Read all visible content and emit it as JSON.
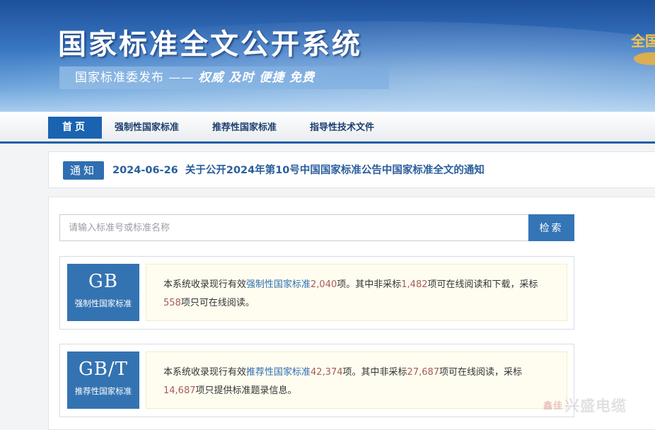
{
  "header": {
    "title": "国家标准全文公开系统",
    "subtitle_prefix": "国家标准委发布 ——",
    "subtitle_slogan": "权威 及时 便捷 免费",
    "right_partial": "全国"
  },
  "nav": {
    "items": [
      {
        "label": "首页",
        "active": true
      },
      {
        "label": "强制性国家标准"
      },
      {
        "label": "推荐性国家标准"
      },
      {
        "label": "指导性技术文件"
      }
    ]
  },
  "notice": {
    "badge": "通知",
    "date": "2024-06-26",
    "text": "关于公开2024年第10号中国国家标准公告中国家标准全文的通知"
  },
  "search": {
    "placeholder": "请输入标准号或标准名称",
    "button_label": "检索"
  },
  "cards": [
    {
      "code": "GB",
      "label": "强制性国家标准",
      "p1": "本系统收录现行有效",
      "link": "强制性国家标准",
      "total": "2,040",
      "p2": "项。其中非采标",
      "nonadopted": "1,482",
      "p3": "项可在线阅读和下载，采标",
      "adopted": "558",
      "p4": "项只可在线阅读。"
    },
    {
      "code": "GB/T",
      "label": "推荐性国家标准",
      "p1": "本系统收录现行有效",
      "link": "推荐性国家标准",
      "total": "42,374",
      "p2": "项。其中非采标",
      "nonadopted": "27,687",
      "p3": "项可在线阅读，采标",
      "adopted": "14,687",
      "p4": "项只提供标准题录信息。"
    }
  ],
  "watermark": {
    "small": "鑫佳",
    "text": "兴盛电缆"
  },
  "colors": {
    "primary": "#1a63b0",
    "badge": "#3473b2",
    "desc_bg": "#fffdf0",
    "number": "#a85a5a"
  }
}
